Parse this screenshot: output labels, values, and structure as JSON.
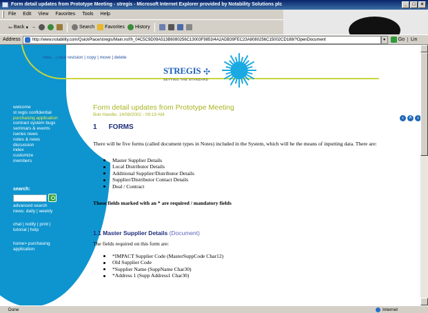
{
  "window": {
    "title": "Form detail updates from Prototype Meeting - stregis - Microsoft Internet Explorer provided by Notability Solutions plc",
    "controls": [
      "_",
      "□",
      "×"
    ]
  },
  "menu": [
    "File",
    "Edit",
    "View",
    "Favorites",
    "Tools",
    "Help"
  ],
  "toolbar": {
    "back": "Back",
    "forward": "→",
    "search": "Search",
    "favorites": "Favorites",
    "history": "History"
  },
  "address": {
    "label": "Address",
    "url": "http://www.notability.com/QuickPlace/stregis/Main.nsf/h_04C5C9D09A513B6080256C13003F9853/4A2ADB39FEC23A8080256C15002CD188/?OpenDocument",
    "go": "Go",
    "links": "Lin"
  },
  "actions": "new... | new revision | copy | move | delete",
  "logo": {
    "name": "STREGIS",
    "tagline": "SETTING THE STANDARD"
  },
  "nav": {
    "items": [
      {
        "label": "welcome",
        "active": false
      },
      {
        "label": "st regis confidential",
        "active": false
      },
      {
        "label": "purchasing application",
        "active": true
      },
      {
        "label": "contract system bugs",
        "active": false
      },
      {
        "label": "seminars & events",
        "active": false
      },
      {
        "label": "iseries news",
        "active": false
      },
      {
        "label": "notes & news",
        "active": false
      },
      {
        "label": "discussion",
        "active": false
      },
      {
        "label": "index",
        "active": false
      },
      {
        "label": "customize",
        "active": false
      },
      {
        "label": "members",
        "active": false
      }
    ]
  },
  "search": {
    "label": "search:",
    "advanced": "advanced search",
    "news": "news: daily | weekly"
  },
  "tools": {
    "line1": "chat | notify | print |",
    "line2": "tutorial | help"
  },
  "breadcrumb": {
    "line1": "home> purchasing",
    "line2": "application"
  },
  "page": {
    "title": "Form detail updates from Prototype Meeting",
    "byline": "Bob Handle, 14/08/2002 - 09:19 AM",
    "section_num": "1",
    "section_title": "FORMS",
    "intro": "There will be five forms (called document types in Notes) included in the System, which will be the means of inputting data. There are:",
    "forms": [
      "Master Supplier Details",
      "Local Distributor Details",
      "Additional Supplier/Distributor Details",
      "Supplier/Distributor Contact Details",
      "Deal / Contract"
    ],
    "required_note": "Those fields marked with an * are required / mandatory fields",
    "subsection": "1.1 Master Supplier Details",
    "subsection_doc": "(Document)",
    "fields_intro": "The fields required on this form are:",
    "fields": [
      "*IMPACT Supplier Code (MasterSuppCode Char12)",
      "Old Supplier Code",
      "*Supplier Name (SuppName Char30)",
      "*Address 1 (Supp Address1 Char30)"
    ]
  },
  "status": {
    "left": "Done",
    "zone": "Internet"
  }
}
